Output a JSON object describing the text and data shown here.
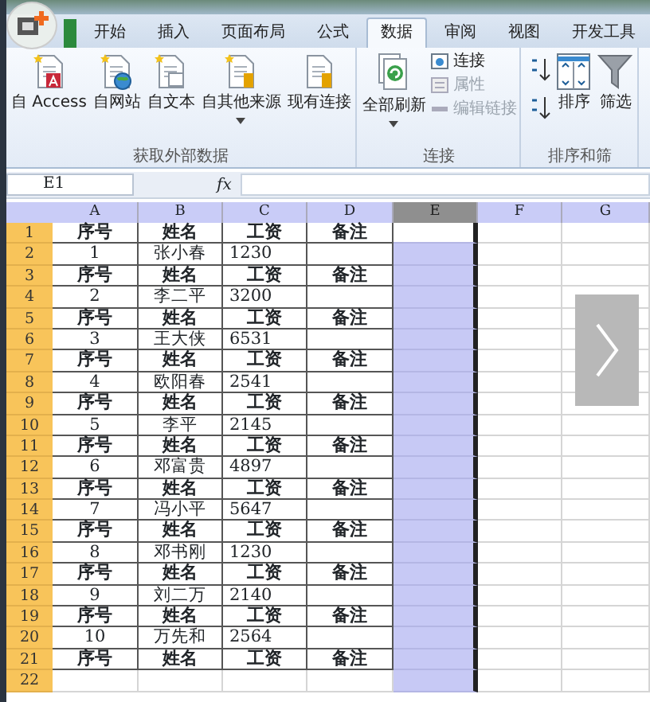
{
  "tabs": [
    {
      "label": "开始",
      "selected": false
    },
    {
      "label": "插入",
      "selected": false
    },
    {
      "label": "页面布局",
      "selected": false
    },
    {
      "label": "公式",
      "selected": false
    },
    {
      "label": "数据",
      "selected": true
    },
    {
      "label": "审阅",
      "selected": false
    },
    {
      "label": "视图",
      "selected": false
    },
    {
      "label": "开发工具",
      "selected": false
    }
  ],
  "ribbon": [
    {
      "label": "获取外部数据",
      "buttons": [
        {
          "label": "自 Access",
          "kind": "access"
        },
        {
          "label": "自网站",
          "kind": "web"
        },
        {
          "label": "自文本",
          "kind": "text"
        },
        {
          "label": "自其他来源",
          "kind": "other",
          "dropdown": true
        },
        {
          "label": "现有连接",
          "kind": "existing"
        }
      ]
    },
    {
      "label": "连接",
      "buttons": [
        {
          "label": "全部刷新",
          "kind": "refresh",
          "dropdown": true
        },
        {
          "label": "连接",
          "kind": "small-connect",
          "disabled": false
        },
        {
          "label": "属性",
          "kind": "small-props",
          "disabled": true
        },
        {
          "label": "编辑链接",
          "kind": "small-links",
          "disabled": true
        }
      ]
    },
    {
      "label": "排序和筛",
      "buttons": [
        {
          "kind": "sort-az"
        },
        {
          "kind": "sort-za"
        },
        {
          "label": "排序",
          "kind": "sort"
        },
        {
          "label": "筛选",
          "kind": "filter"
        }
      ]
    }
  ],
  "name_box": "E1",
  "formula_label": "fx",
  "columns": [
    {
      "label": "A",
      "selected": false
    },
    {
      "label": "B",
      "selected": false
    },
    {
      "label": "C",
      "selected": false
    },
    {
      "label": "D",
      "selected": false
    },
    {
      "label": "E",
      "selected": true
    },
    {
      "label": "F",
      "selected": false
    },
    {
      "label": "G",
      "selected": false
    }
  ],
  "rows": [
    {
      "number": "1",
      "kind": "header",
      "active": true,
      "cells": [
        "序号",
        "姓名",
        "工资",
        "备注"
      ]
    },
    {
      "number": "2",
      "kind": "data",
      "active": false,
      "cells": [
        "1",
        "张小春",
        "1230"
      ]
    },
    {
      "number": "3",
      "kind": "header",
      "active": false,
      "cells": [
        "序号",
        "姓名",
        "工资",
        "备注"
      ]
    },
    {
      "number": "4",
      "kind": "data",
      "active": false,
      "cells": [
        "2",
        "李二平",
        "3200"
      ]
    },
    {
      "number": "5",
      "kind": "header",
      "active": false,
      "cells": [
        "序号",
        "姓名",
        "工资",
        "备注"
      ]
    },
    {
      "number": "6",
      "kind": "data",
      "active": false,
      "cells": [
        "3",
        "王大侠",
        "6531"
      ]
    },
    {
      "number": "7",
      "kind": "header",
      "active": false,
      "cells": [
        "序号",
        "姓名",
        "工资",
        "备注"
      ]
    },
    {
      "number": "8",
      "kind": "data",
      "active": false,
      "cells": [
        "4",
        "欧阳春",
        "2541"
      ]
    },
    {
      "number": "9",
      "kind": "header",
      "active": false,
      "cells": [
        "序号",
        "姓名",
        "工资",
        "备注"
      ]
    },
    {
      "number": "10",
      "kind": "data",
      "active": false,
      "cells": [
        "5",
        "李平",
        "2145"
      ]
    },
    {
      "number": "11",
      "kind": "header",
      "active": false,
      "cells": [
        "序号",
        "姓名",
        "工资",
        "备注"
      ]
    },
    {
      "number": "12",
      "kind": "data",
      "active": false,
      "cells": [
        "6",
        "邓富贵",
        "4897"
      ]
    },
    {
      "number": "13",
      "kind": "header",
      "active": false,
      "cells": [
        "序号",
        "姓名",
        "工资",
        "备注"
      ]
    },
    {
      "number": "14",
      "kind": "data",
      "active": false,
      "cells": [
        "7",
        "冯小平",
        "5647"
      ]
    },
    {
      "number": "15",
      "kind": "header",
      "active": false,
      "cells": [
        "序号",
        "姓名",
        "工资",
        "备注"
      ]
    },
    {
      "number": "16",
      "kind": "data",
      "active": false,
      "cells": [
        "8",
        "邓书刚",
        "1230"
      ]
    },
    {
      "number": "17",
      "kind": "header",
      "active": false,
      "cells": [
        "序号",
        "姓名",
        "工资",
        "备注"
      ]
    },
    {
      "number": "18",
      "kind": "data",
      "active": false,
      "cells": [
        "9",
        "刘二万",
        "2140"
      ]
    },
    {
      "number": "19",
      "kind": "header",
      "active": false,
      "cells": [
        "序号",
        "姓名",
        "工资",
        "备注"
      ]
    },
    {
      "number": "20",
      "kind": "data",
      "active": false,
      "cells": [
        "10",
        "万先和",
        "2564"
      ]
    },
    {
      "number": "21",
      "kind": "header",
      "active": false,
      "cells": [
        "序号",
        "姓名",
        "工资",
        "备注"
      ]
    },
    {
      "number": "22",
      "kind": "empty",
      "active": false,
      "cells": []
    }
  ]
}
